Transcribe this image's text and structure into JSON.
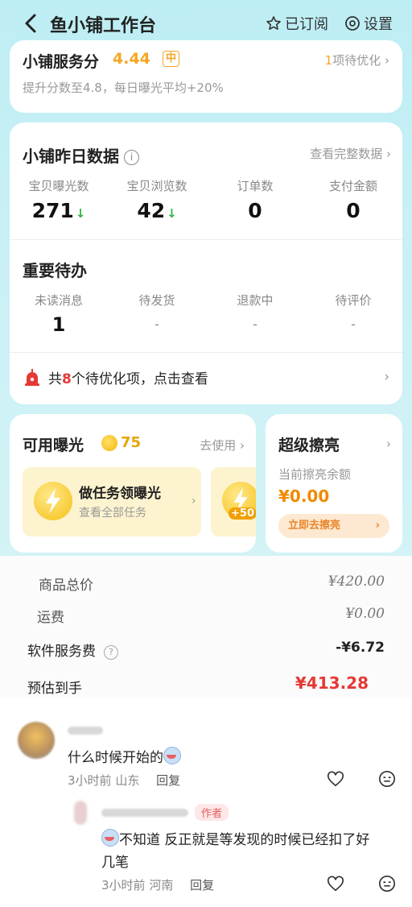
{
  "nav": {
    "title": "鱼小铺工作台",
    "subscribed": "已订阅",
    "settings": "设置"
  },
  "score_card": {
    "title": "小铺服务分",
    "value": "4.44",
    "badge": "中",
    "link_count": "1",
    "link_text": "项待优化",
    "desc": "提升分数至4.8，每日曝光平均+20%"
  },
  "data_card": {
    "title": "小铺昨日数据",
    "link": "查看完整数据",
    "stats": [
      {
        "label": "宝贝曝光数",
        "value": "271"
      },
      {
        "label": "宝贝浏览数",
        "value": "42"
      },
      {
        "label": "订单数",
        "value": "0"
      },
      {
        "label": "支付金额",
        "value": "0"
      }
    ],
    "todo_title": "重要待办",
    "todos": [
      {
        "label": "未读消息",
        "value": "1"
      },
      {
        "label": "待发货",
        "value": "-"
      },
      {
        "label": "退款中",
        "value": "-"
      },
      {
        "label": "待评价",
        "value": "-"
      }
    ],
    "alert_prefix": "共",
    "alert_count": "8",
    "alert_suffix": "个待优化项，点击查看"
  },
  "exposure_card": {
    "title": "可用曝光",
    "value": "75",
    "link": "去使用",
    "task_title": "做任务领曝光",
    "task_sub": "查看全部任务",
    "bonus": "+50"
  },
  "shine_card": {
    "title": "超级擦亮",
    "sub": "当前擦亮余额",
    "value": "¥0.00",
    "button": "立即去擦亮"
  },
  "price": {
    "rows": [
      {
        "label": "商品总价",
        "value": "¥420.00"
      },
      {
        "label": "运费",
        "value": "¥0.00"
      },
      {
        "label": "软件服务费",
        "value": "-¥6.72"
      },
      {
        "label": "预估到手",
        "value": "¥413.28"
      }
    ]
  },
  "comments": [
    {
      "text": "什么时候开始的",
      "time": "3小时前",
      "location": "山东",
      "reply": "回复"
    },
    {
      "author_tag": "作者",
      "text_line1": "不知道 反正就是等发现的时候已经扣了好",
      "text_line2": "几笔",
      "time": "3小时前",
      "location": "河南",
      "reply": "回复"
    }
  ],
  "colors": {
    "accent_orange": "#f5a623",
    "alert_red": "#e53935",
    "price_red": "#e53935",
    "down_green": "#2eb34a",
    "header_bg": "#c8f0f5"
  }
}
